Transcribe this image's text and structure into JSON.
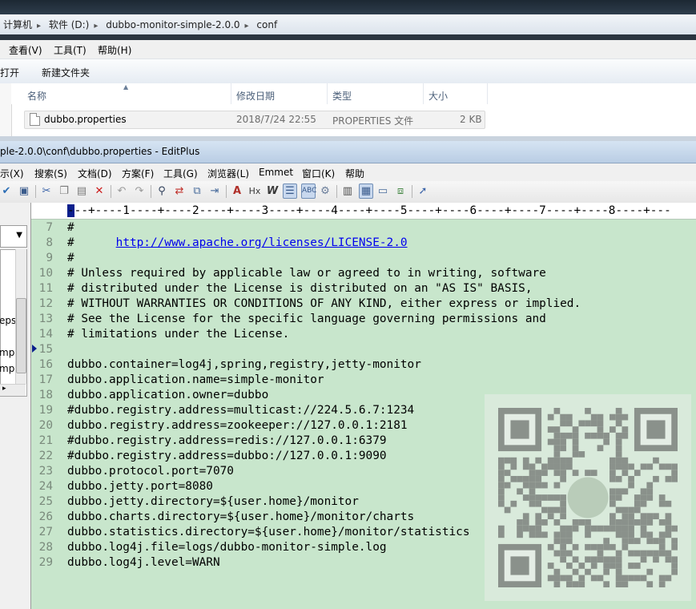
{
  "explorer": {
    "breadcrumb": [
      "计算机",
      "软件 (D:)",
      "dubbo-monitor-simple-2.0.0",
      "conf"
    ],
    "menu": [
      "查看(V)",
      "工具(T)",
      "帮助(H)"
    ],
    "commands": [
      "打开",
      "新建文件夹"
    ],
    "columns": {
      "name": "名称",
      "modified": "修改日期",
      "type": "类型",
      "size": "大小"
    },
    "file": {
      "name": "dubbo.properties",
      "modified": "2018/7/24 22:55",
      "type": "PROPERTIES 文件",
      "size": "2 KB"
    }
  },
  "editplus": {
    "title": "ple-2.0.0\\conf\\dubbo.properties - EditPlus",
    "menu": [
      "示(X)",
      "搜索(S)",
      "文档(D)",
      "方案(F)",
      "工具(G)",
      "浏览器(L)",
      "Emmet",
      "窗口(K)",
      "帮助"
    ],
    "ruler": "---+----1----+----2----+----3----+----4----+----5----+----6----+----7----+----8----+---",
    "sidebar_fragments": [
      "eps",
      "mp",
      "mp"
    ],
    "code_lines": [
      {
        "n": "7",
        "text": "#"
      },
      {
        "n": "8",
        "text": "#      ",
        "link": "http://www.apache.org/licenses/LICENSE-2.0"
      },
      {
        "n": "9",
        "text": "#"
      },
      {
        "n": "10",
        "text": "# Unless required by applicable law or agreed to in writing, software"
      },
      {
        "n": "11",
        "text": "# distributed under the License is distributed on an \"AS IS\" BASIS,"
      },
      {
        "n": "12",
        "text": "# WITHOUT WARRANTIES OR CONDITIONS OF ANY KIND, either express or implied."
      },
      {
        "n": "13",
        "text": "# See the License for the specific language governing permissions and"
      },
      {
        "n": "14",
        "text": "# limitations under the License."
      },
      {
        "n": "15",
        "text": ""
      },
      {
        "n": "16",
        "text": "dubbo.container=log4j,spring,registry,jetty-monitor"
      },
      {
        "n": "17",
        "text": "dubbo.application.name=simple-monitor"
      },
      {
        "n": "18",
        "text": "dubbo.application.owner=dubbo"
      },
      {
        "n": "19",
        "text": "#dubbo.registry.address=multicast://224.5.6.7:1234"
      },
      {
        "n": "20",
        "text": "dubbo.registry.address=zookeeper://127.0.0.1:2181"
      },
      {
        "n": "21",
        "text": "#dubbo.registry.address=redis://127.0.0.1:6379"
      },
      {
        "n": "22",
        "text": "#dubbo.registry.address=dubbo://127.0.0.1:9090"
      },
      {
        "n": "23",
        "text": "dubbo.protocol.port=7070"
      },
      {
        "n": "24",
        "text": "dubbo.jetty.port=8080"
      },
      {
        "n": "25",
        "text": "dubbo.jetty.directory=${user.home}/monitor"
      },
      {
        "n": "26",
        "text": "dubbo.charts.directory=${user.home}/monitor/charts"
      },
      {
        "n": "27",
        "text": "dubbo.statistics.directory=${user.home}/monitor/statistics"
      },
      {
        "n": "28",
        "text": "dubbo.log4j.file=logs/dubbo-monitor-simple.log"
      },
      {
        "n": "29",
        "text": "dubbo.log4j.level=WARN"
      }
    ]
  },
  "colors": {
    "editor_bg": "#c8e6cc",
    "link": "#0000ee",
    "line_number": "#7a8a7c"
  }
}
